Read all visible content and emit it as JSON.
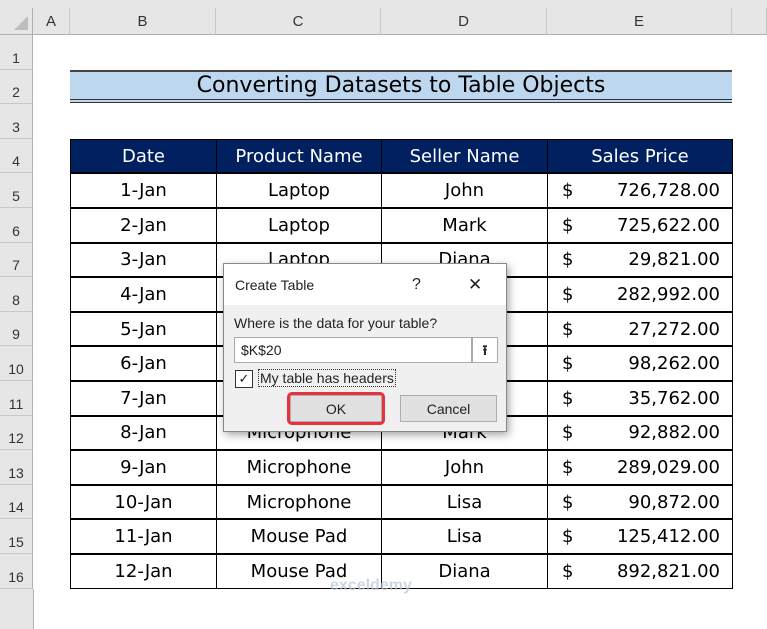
{
  "columns": [
    "A",
    "B",
    "C",
    "D",
    "E"
  ],
  "rows": [
    "1",
    "2",
    "3",
    "4",
    "5",
    "6",
    "7",
    "8",
    "9",
    "10",
    "11",
    "12",
    "13",
    "14",
    "15",
    "16"
  ],
  "title": "Converting Datasets to Table Objects",
  "headers": [
    "Date",
    "Product Name",
    "Seller Name",
    "Sales Price"
  ],
  "data": [
    [
      "1-Jan",
      "Laptop",
      "John",
      "$",
      "726,728.00"
    ],
    [
      "2-Jan",
      "Laptop",
      "Mark",
      "$",
      "725,622.00"
    ],
    [
      "3-Jan",
      "Laptop",
      "Diana",
      "$",
      "29,821.00"
    ],
    [
      "4-Jan",
      "",
      "",
      "$",
      "282,992.00"
    ],
    [
      "5-Jan",
      "",
      "",
      "$",
      "27,272.00"
    ],
    [
      "6-Jan",
      "",
      "",
      "$",
      "98,262.00"
    ],
    [
      "7-Jan",
      "",
      "",
      "$",
      "35,762.00"
    ],
    [
      "8-Jan",
      "Microphone",
      "Mark",
      "$",
      "92,882.00"
    ],
    [
      "9-Jan",
      "Microphone",
      "John",
      "$",
      "289,029.00"
    ],
    [
      "10-Jan",
      "Microphone",
      "Lisa",
      "$",
      "90,872.00"
    ],
    [
      "11-Jan",
      "Mouse Pad",
      "Lisa",
      "$",
      "125,412.00"
    ],
    [
      "12-Jan",
      "Mouse Pad",
      "Diana",
      "$",
      "892,821.00"
    ]
  ],
  "dialog": {
    "title": "Create Table",
    "help": "?",
    "close": "✕",
    "prompt": "Where is the data for your table?",
    "range": "$K$20",
    "collapse_icon": "⭱",
    "checkbox_label": "My table has headers",
    "checkbox_checked": true,
    "ok": "OK",
    "cancel": "Cancel",
    "highlight_color": "#e8323c"
  },
  "watermark": "exceldemy"
}
